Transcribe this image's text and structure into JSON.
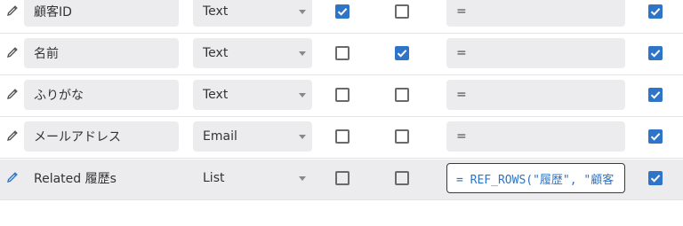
{
  "columns": [
    {
      "name": "顧客ID",
      "type": "Text",
      "check_a": true,
      "check_b": false,
      "formula": "=",
      "check_c": true,
      "selected": false
    },
    {
      "name": "名前",
      "type": "Text",
      "check_a": false,
      "check_b": true,
      "formula": "=",
      "check_c": true,
      "selected": false
    },
    {
      "name": "ふりがな",
      "type": "Text",
      "check_a": false,
      "check_b": false,
      "formula": "=",
      "check_c": true,
      "selected": false
    },
    {
      "name": "メールアドレス",
      "type": "Email",
      "check_a": false,
      "check_b": false,
      "formula": "=",
      "check_c": true,
      "selected": false
    },
    {
      "name": "Related 履歴s",
      "type": "List",
      "check_a": false,
      "check_b": false,
      "formula": "= REF_ROWS(\"履歴\", \"顧客",
      "check_c": true,
      "selected": true
    }
  ],
  "colors": {
    "accent": "#2e74c8",
    "selected_row": "#ececee",
    "field_bg": "#ececef"
  },
  "icons": {
    "edit": "pencil-icon",
    "dropdown": "chevron-down-icon",
    "checked": "check-icon"
  }
}
